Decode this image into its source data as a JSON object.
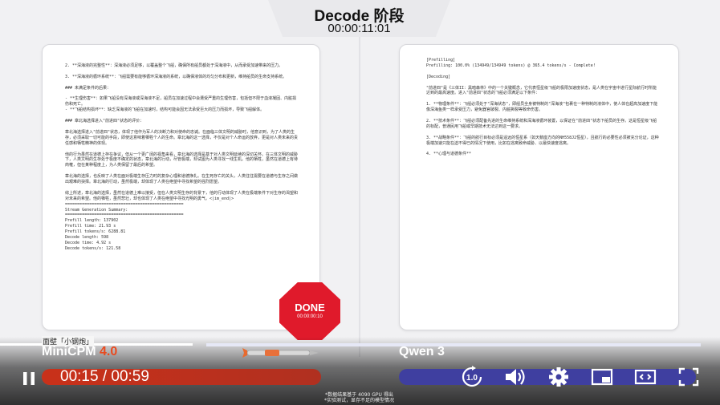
{
  "header": {
    "title": "Decode 阶段",
    "timer": "00:00:11:01"
  },
  "left_panel": {
    "text": "2. **深海液的完整性**：深海液必须足够，以覆盖整个飞船，确保所有船员都处于深海液中，从而承受加速带来的压力。\n\n3. **深海液的循环系统**：飞船需要有能够循环深海液的系统，以确保液体的均匀分布和更新，维持船员的生命支持系统。\n\n### 未满足条件的后果：\n\n- **生理伤害**：如果飞船没有深海液或深海液不足，船员在加速过程中会遭受严重的生理伤害，包括但不限于血液凝固、内脏损伤和死亡。\n- **飞船结构损坏**：缺乏深海液的飞船在加速时，结构可能会因无法承受巨大的压力而损坏，导致飞船解体。\n\n### 章北海选择进入\"前进四\"状态的评价：\n\n章北海选择进入\"前进四\"状态，体现了他作为军人的决断力和对使命的忠诚。在面临三体文明的威胁时，他意识到，为了人类的生存，必须采取一切可能的手段，即使这意味着牺牲个人的生命。章北海的这一选择，不仅是对个人命运的放弃，更是对人类未来的责任感和牺牲精神的体现。\n\n他的行为虽然在道德上存在争议，但从一个更广阔的视角来看，章北海的选择是基于对人类文明延续的深切关怀。在三体文明的威胁下，人类文明的生存处于极度不确定的状态，章北海的行动，尽管极端，却试图为人类寻找一线生机。他的牺牲，虽然在道德上有待商榷，但在某种程度上，为人类保留了最后的希望。\n\n章北海的选择，也反映了人类在面对极端生存压力时的复杂心理和道德挣扎。在生死存亡的关头，人类往往需要在道德与生存之间做出艰难的抉择。章北海的行动，虽然极端，却体现了人类在绝望中寻找希望的强烈愿望。\n\n综上所述，章北海的选择，虽然在道德上难以接受，但在人类文明生存的背景下，他的行动体现了人类在极端条件下对生存的渴望和对未来的希望。他的牺牲，虽然悲壮，却也体现了人类在绝望中寻找光明的勇气。<|im_end|>\n=================================================\nStream Generation Summary:\n=================================================\nPrefill length: 137902\nPrefill time: 21.93 s\nPrefill tokens/s: 6288.81\nDecode length: 598\nDecode time: 4.92 s\nDecode tokens/s: 121.58"
  },
  "right_panel": {
    "text": "[Prefilling]\nPrefilling: 100.0% (134949/134949 tokens) @ 365.4 tokens/s - Complete!\n\n[Decoding]\n\n\"前进四\"是《三体II：黑暗森林》中的一个关键概念，它代表恒星级飞船的极限加速度状态，是人类在宇宙中进行星际航行时所能达到的最高速度。进入\"前进四\"状态的飞船必须满足以下条件：\n\n1. **物理条件**：飞船必须处于\"深海状态\"，即船员全身被特制的\"深海液\"包裹在一种特制的液体中，使人体在超高加速度下能像深海鱼类一样承受压力，避免器官破裂、内脏撕裂等致命伤害。\n\n2. **技术条件**：飞船必须配备先进的生命维持系统和深海液循环装置，以保证在\"前进四\"状态下船员的生存。这是恒星级飞船的标配，普通民用飞船或早期技术无法达到这一要求。\n\n3. **战略条件**：飞船的航行目标必须是遥远的恒星系（如天鹅座方向的NH558J2恒星），且航行的必要性必须被充分论证，这种极端加速只能在迫不得已的情况下使用，比如在逃离致命威胁、以最快速度逃离。\n\n4. **心理与道德条件**"
  },
  "done_badge": {
    "label": "DONE",
    "time": "00:00:00:10"
  },
  "left_model": {
    "subtitle": "面壁「小钢炮」",
    "name": "MiniCPM",
    "version": "4.0"
  },
  "right_model": {
    "name": "Qwen 3"
  },
  "player": {
    "time_display": "00:15 / 00:59",
    "current_seconds": 15,
    "total_seconds": 59,
    "speed_label": "1.0"
  },
  "footnote": {
    "line1": "*数据结果基于 4090 GPU 得出",
    "line2": "*实验测试，显存不足的模型情况"
  },
  "colors": {
    "done_red": "#e01a2b",
    "left_progress": "#c9311a",
    "right_progress": "#3f3fa0",
    "minicpm_accent": "#e94a1f"
  },
  "icons": {
    "play": "pause-icon",
    "speed": "speed-icon",
    "volume": "volume-icon",
    "settings": "gear-icon",
    "miniplayer": "miniplayer-icon",
    "theater": "theater-icon",
    "fullscreen": "fullscreen-icon"
  }
}
